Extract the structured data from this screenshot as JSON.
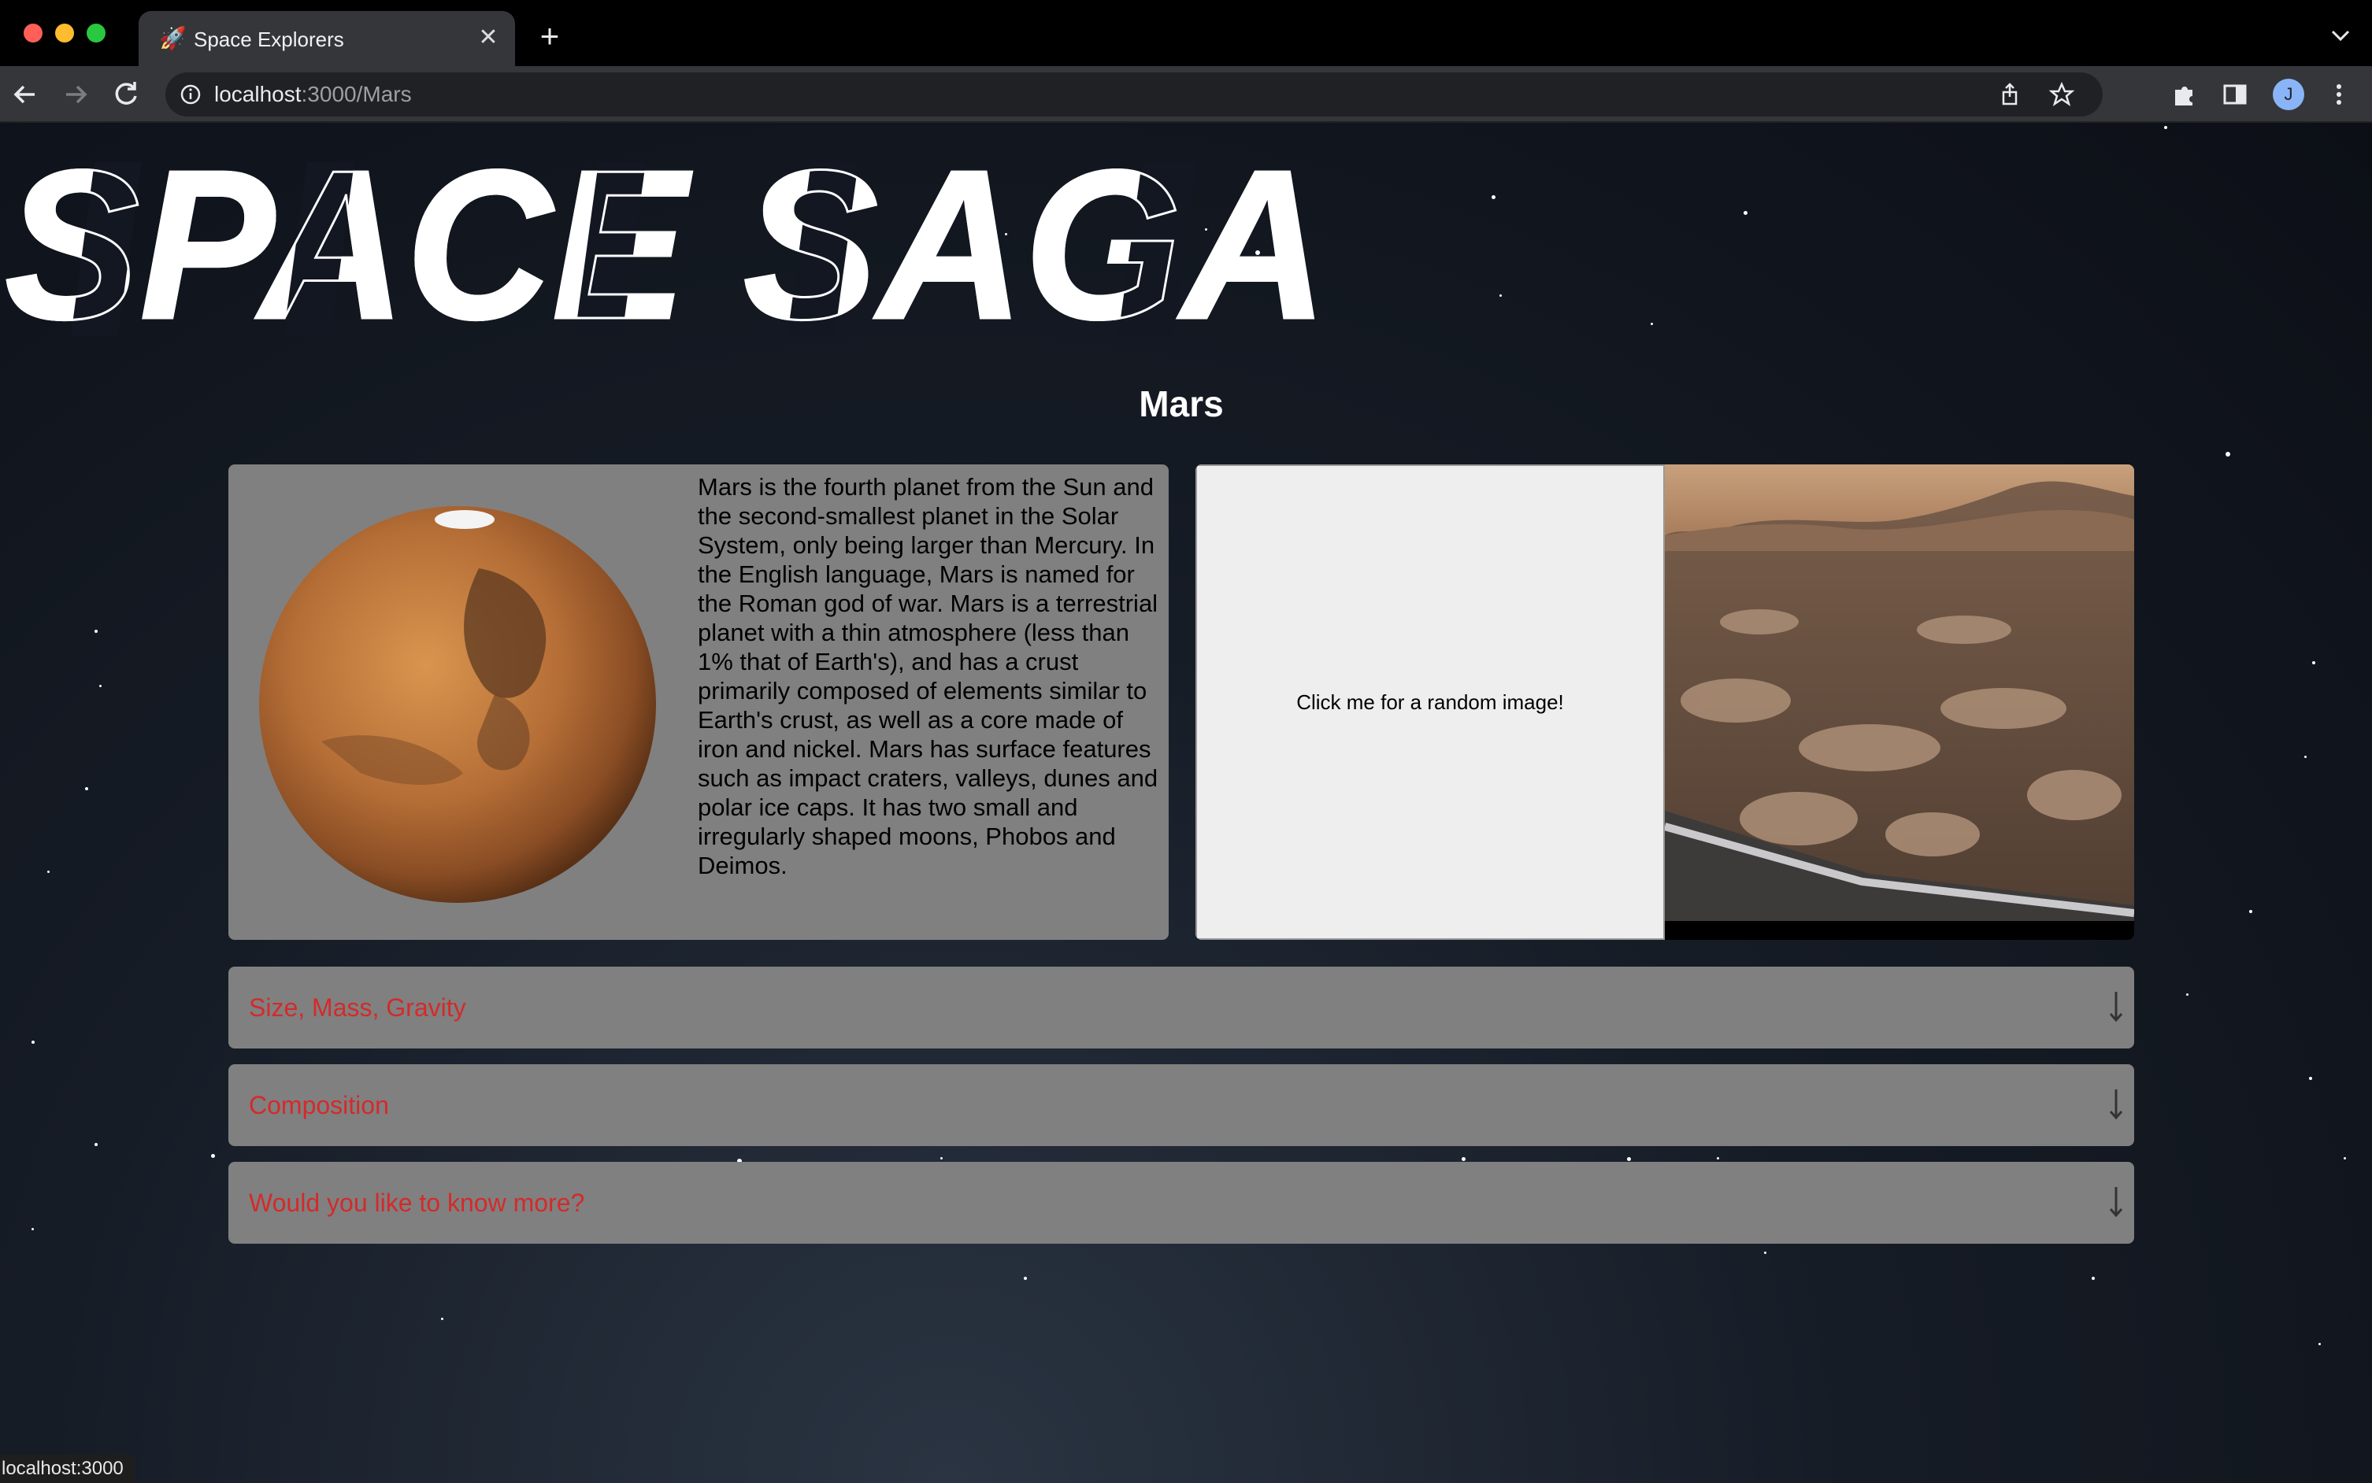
{
  "browser": {
    "tab_title": "Space Explorers",
    "tab_icon": "rocket-icon",
    "url_host": "localhost",
    "url_rest": ":3000/Mars",
    "profile_initial": "J",
    "status_text": "localhost:3000"
  },
  "page": {
    "site_title": "SPACE SAGA",
    "planet_name": "Mars",
    "description": "Mars is the fourth planet from the Sun and the second-smallest planet in the Solar System, only being larger than Mercury. In the English language, Mars is named for the Roman god of war. Mars is a terrestrial planet with a thin atmosphere (less than 1% that of Earth's), and has a crust primarily composed of elements similar to Earth's crust, as well as a core made of iron and nickel. Mars has surface features such as impact craters, valleys, dunes and polar ice caps. It has two small and irregularly shaped moons, Phobos and Deimos.",
    "random_image_button": "Click me for a random image!",
    "accordions": [
      {
        "label": "Size, Mass, Gravity",
        "icon": "arrow-down-icon"
      },
      {
        "label": "Composition",
        "icon": "arrow-down-icon"
      },
      {
        "label": "Would you like to know more?",
        "icon": "arrow-down-icon"
      }
    ]
  },
  "colors": {
    "accordion_label": "#d42a2a",
    "card_background": "#808080",
    "button_background": "#eeeeee"
  }
}
